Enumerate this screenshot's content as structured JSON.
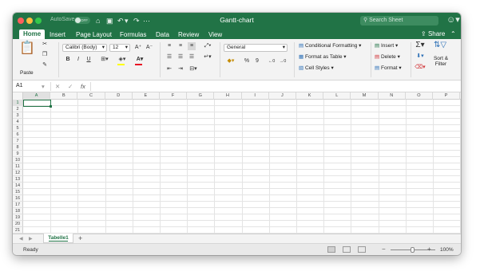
{
  "title_bar": {
    "autosave_label": "AutoSave",
    "autosave_state": "OFF",
    "doc_title": "Gantt-chart",
    "search_placeholder": "Search Sheet",
    "brand_color": "#217346"
  },
  "ribbon_tabs": [
    "Home",
    "Insert",
    "Page Layout",
    "Formulas",
    "Data",
    "Review",
    "View"
  ],
  "active_tab": "Home",
  "share_label": "Share",
  "ribbon": {
    "paste_label": "Paste",
    "font_name": "Calibri (Body)",
    "font_size": "12",
    "bold": "B",
    "italic": "I",
    "underline": "U",
    "number_format": "General",
    "percent": "%",
    "comma": "9",
    "conditional_formatting": "Conditional Formatting",
    "format_as_table": "Format as Table",
    "cell_styles": "Cell Styles",
    "insert": "Insert",
    "delete": "Delete",
    "format": "Format",
    "sort_filter_line1": "Sort &",
    "sort_filter_line2": "Filter"
  },
  "formula_bar": {
    "name_box": "A1",
    "fx": "fx",
    "value": ""
  },
  "columns": [
    "A",
    "B",
    "C",
    "D",
    "E",
    "F",
    "G",
    "H",
    "I",
    "J",
    "K",
    "L",
    "M",
    "N",
    "O",
    "P"
  ],
  "rows": [
    "1",
    "2",
    "3",
    "4",
    "5",
    "6",
    "7",
    "8",
    "9",
    "10",
    "11",
    "12",
    "13",
    "14",
    "15",
    "16",
    "17",
    "18",
    "19",
    "20",
    "21"
  ],
  "selected_cell": "A1",
  "sheets": [
    "Tabelle1"
  ],
  "active_sheet": "Tabelle1",
  "status": {
    "state": "Ready",
    "zoom": "100%",
    "zoom_minus": "−",
    "zoom_plus": "+"
  }
}
